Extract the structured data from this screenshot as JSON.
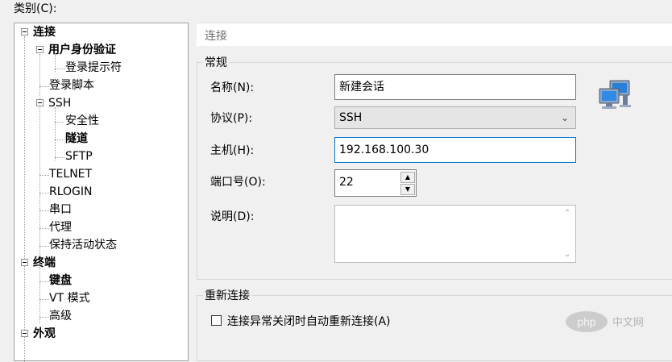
{
  "category_label": "类别(C):",
  "tree": [
    {
      "id": "connection",
      "label": "连接",
      "bold": true,
      "expander": true
    },
    {
      "id": "auth",
      "label": "用户身份验证",
      "bold": true,
      "expander": true
    },
    {
      "id": "login-prompt",
      "label": "登录提示符",
      "bold": false
    },
    {
      "id": "login-script",
      "label": "登录脚本",
      "bold": false
    },
    {
      "id": "ssh",
      "label": "SSH",
      "bold": false,
      "expander": true
    },
    {
      "id": "security",
      "label": "安全性",
      "bold": false
    },
    {
      "id": "tunnel",
      "label": "隧道",
      "bold": true
    },
    {
      "id": "sftp",
      "label": "SFTP",
      "bold": false
    },
    {
      "id": "telnet",
      "label": "TELNET",
      "bold": false
    },
    {
      "id": "rlogin",
      "label": "RLOGIN",
      "bold": false
    },
    {
      "id": "serial",
      "label": "串口",
      "bold": false
    },
    {
      "id": "proxy",
      "label": "代理",
      "bold": false
    },
    {
      "id": "keepalive",
      "label": "保持活动状态",
      "bold": false
    },
    {
      "id": "terminal",
      "label": "终端",
      "bold": true,
      "expander": true
    },
    {
      "id": "keyboard",
      "label": "键盘",
      "bold": true
    },
    {
      "id": "vt-mode",
      "label": "VT 模式",
      "bold": false
    },
    {
      "id": "advanced",
      "label": "高级",
      "bold": false
    },
    {
      "id": "appearance",
      "label": "外观",
      "bold": true,
      "expander": true
    }
  ],
  "header_title": "连接",
  "general": {
    "title": "常规",
    "name_label": "名称(N):",
    "name_value": "新建会话",
    "protocol_label": "协议(P):",
    "protocol_value": "SSH",
    "host_label": "主机(H):",
    "host_value": "192.168.100.30",
    "port_label": "端口号(O):",
    "port_value": "22",
    "desc_label": "说明(D):",
    "desc_value": ""
  },
  "reconnect": {
    "title": "重新连接",
    "checkbox_label": "连接异常关闭时自动重新连接(A)",
    "checked": false
  },
  "watermark": "php 中文网",
  "colors": {
    "focus_border": "#0078d7",
    "selection_bg": "#e5e5e5"
  }
}
